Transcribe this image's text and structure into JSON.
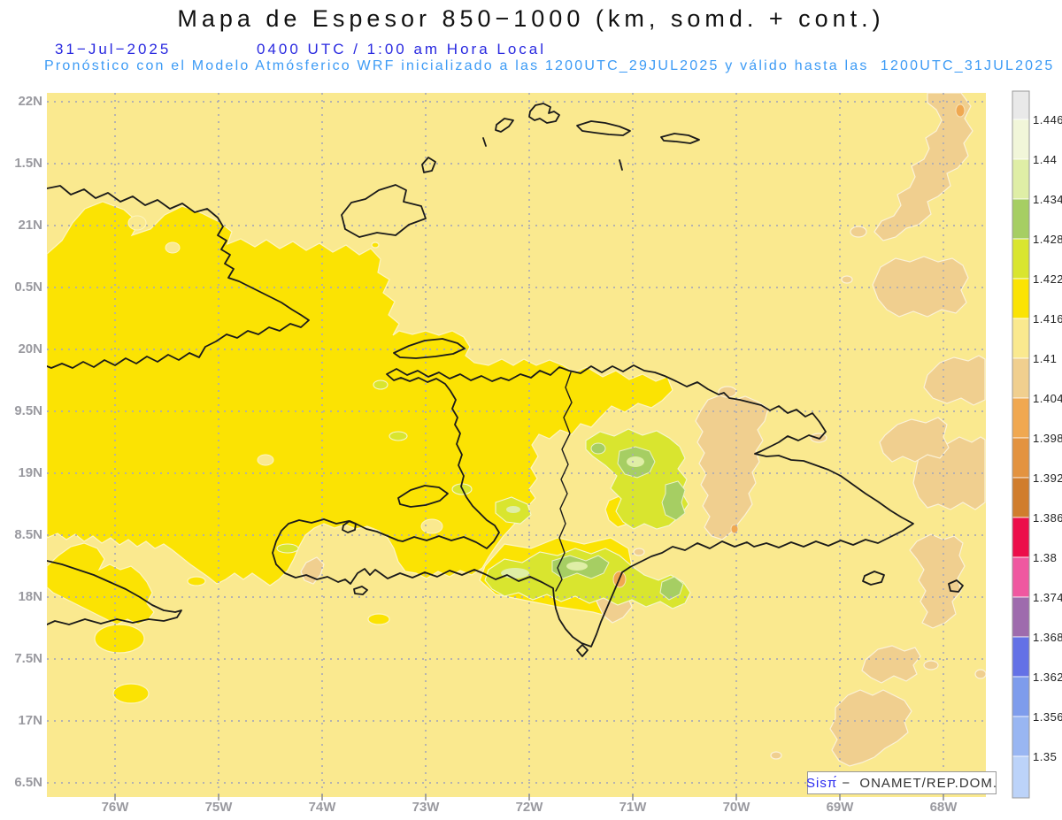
{
  "header": {
    "title": "Mapa de Espesor 850−1000 (km, somd. + cont.)",
    "date": "31−Jul−2025",
    "time": "0400 UTC / 1:00 am Hora Local",
    "forecast": "Pronóstico con el Modelo Atmósferico WRF inicializado a las 1200UTC_29JUL2025 y válido hasta las  1200UTC_31JUL2025"
  },
  "axes": {
    "lat": [
      "22N",
      "1.5N",
      "21N",
      "0.5N",
      "20N",
      "9.5N",
      "19N",
      "8.5N",
      "18N",
      "7.5N",
      "17N",
      "6.5N"
    ],
    "lon": [
      "76W",
      "75W",
      "74W",
      "73W",
      "72W",
      "71W",
      "70W",
      "69W",
      "68W"
    ]
  },
  "colorbar": {
    "labels": [
      "1.446",
      "1.44",
      "1.434",
      "1.428",
      "1.422",
      "1.416",
      "1.41",
      "1.404",
      "1.398",
      "1.392",
      "1.386",
      "1.38",
      "1.374",
      "1.368",
      "1.362",
      "1.356",
      "1.35"
    ],
    "colors": [
      "#E9E9E9",
      "#F1F6D9",
      "#DFEEA6",
      "#A6CE63",
      "#D9E52F",
      "#FBE303",
      "#FAE98F",
      "#F0CF8F",
      "#F0A851",
      "#E39340",
      "#D07D2D",
      "#EC0E4A",
      "#EF58A0",
      "#9E6BAD",
      "#6471E6",
      "#7E9CEC",
      "#99B6F2",
      "#BCD3F9"
    ]
  },
  "palette": {
    "background": "#FAE98F",
    "yellow": "#FBE303",
    "tan": "#F0CF8F",
    "orange": "#F0A851",
    "chartreuse": "#D9E52F",
    "green": "#A6CE63",
    "pale_green": "#DFEEA6",
    "coastline": "#1A1A1A"
  },
  "attribution": {
    "brand": "Sisπ́",
    "text": " −  ONAMET/REP.DOM."
  }
}
